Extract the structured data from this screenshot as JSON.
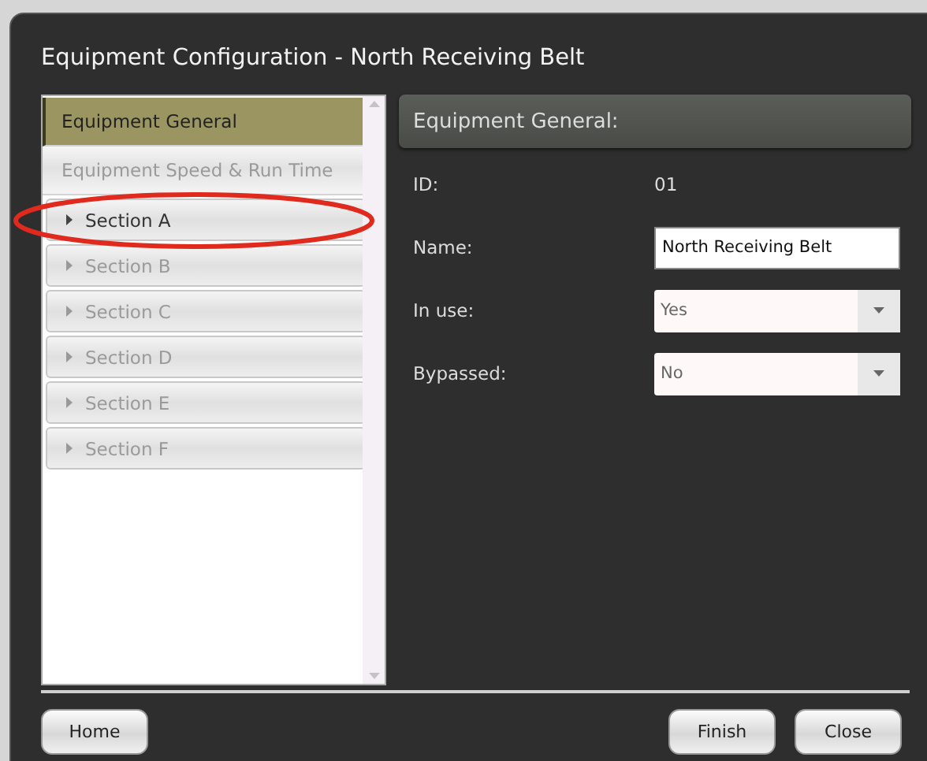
{
  "window": {
    "title": "Equipment Configuration - North Receiving Belt"
  },
  "nav": {
    "items": [
      {
        "label": "Equipment General",
        "kind": "page",
        "selected": true,
        "disabled": false
      },
      {
        "label": "Equipment Speed & Run Time",
        "kind": "page",
        "selected": false,
        "disabled": true
      },
      {
        "label": "Section A",
        "kind": "section",
        "selected": false,
        "disabled": false
      },
      {
        "label": "Section B",
        "kind": "section",
        "selected": false,
        "disabled": true
      },
      {
        "label": "Section C",
        "kind": "section",
        "selected": false,
        "disabled": true
      },
      {
        "label": "Section D",
        "kind": "section",
        "selected": false,
        "disabled": true
      },
      {
        "label": "Section E",
        "kind": "section",
        "selected": false,
        "disabled": true
      },
      {
        "label": "Section F",
        "kind": "section",
        "selected": false,
        "disabled": true
      }
    ]
  },
  "panel": {
    "title": "Equipment General:",
    "fields": [
      {
        "label": "ID:",
        "kind": "text",
        "value": "01"
      },
      {
        "label": "Name:",
        "kind": "input",
        "value": "North Receiving Belt"
      },
      {
        "label": "In use:",
        "kind": "select",
        "value": "Yes"
      },
      {
        "label": "Bypassed:",
        "kind": "select",
        "value": "No"
      }
    ]
  },
  "buttons": {
    "left": [
      "Home"
    ],
    "right": [
      "Finish",
      "Close"
    ]
  }
}
